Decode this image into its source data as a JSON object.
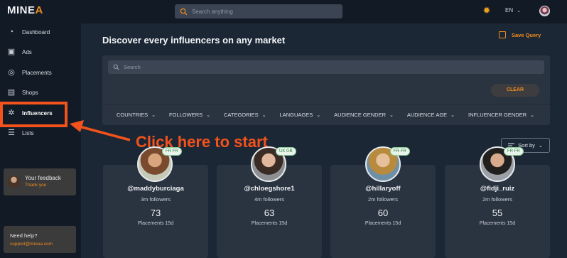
{
  "app": {
    "logo_prefix": "MINE",
    "logo_suffix": "A",
    "accent": "#f08c1e",
    "highlight": "#f2521b"
  },
  "topbar": {
    "search_placeholder": "Search anything",
    "language": "EN",
    "theme_icon": "sun-icon"
  },
  "sidebar": {
    "items": [
      {
        "label": "Dashboard",
        "icon": "dashboard-icon"
      },
      {
        "label": "Ads",
        "icon": "ads-icon"
      },
      {
        "label": "Placements",
        "icon": "placements-icon"
      },
      {
        "label": "Shops",
        "icon": "shops-icon"
      },
      {
        "label": "Influencers",
        "icon": "influencers-icon"
      },
      {
        "label": "Lists",
        "icon": "lists-icon"
      }
    ],
    "feedback": {
      "title": "Your feedback",
      "subtitle": "Thank you"
    },
    "help": {
      "title": "Need help?",
      "email": "support@minea.com"
    }
  },
  "main": {
    "title": "Discover every influencers on any market",
    "save_query": "Save Query",
    "filter_search_placeholder": "Search",
    "clear_label": "CLEAR",
    "filters": [
      "COUNTRIES",
      "FOLLOWERS",
      "CATEGORIES",
      "LANGUAGES",
      "AUDIENCE GENDER",
      "AUDIENCE AGE",
      "INFLUENCER GENDER"
    ],
    "sort_label": "Sort by"
  },
  "annotation": {
    "callout": "Click here to start"
  },
  "cards": [
    {
      "handle": "@maddyburciaga",
      "followers": "3m followers",
      "placements": "73",
      "placements_label": "Placements 15d",
      "badge": "FR FR"
    },
    {
      "handle": "@chloegshore1",
      "followers": "4m followers",
      "placements": "63",
      "placements_label": "Placements 15d",
      "badge": "UK GB"
    },
    {
      "handle": "@hillaryoff",
      "followers": "2m followers",
      "placements": "60",
      "placements_label": "Placements 15d",
      "badge": "FR FR"
    },
    {
      "handle": "@fidji_ruiz",
      "followers": "2m followers",
      "placements": "55",
      "placements_label": "Placements 15d",
      "badge": "FR FR"
    }
  ]
}
